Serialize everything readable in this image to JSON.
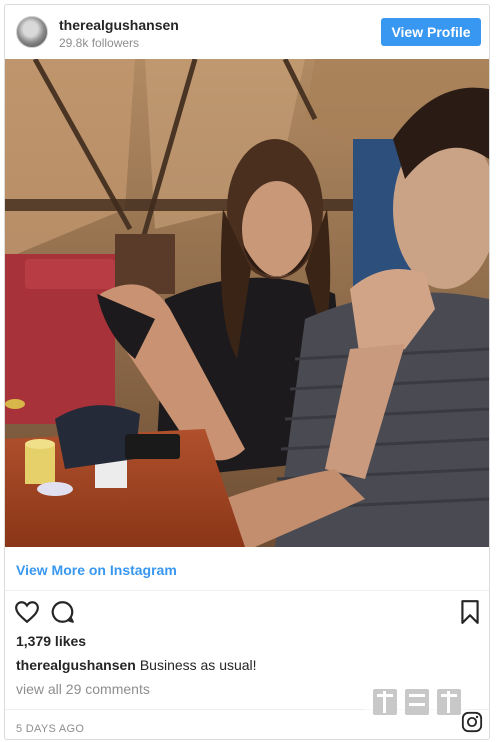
{
  "header": {
    "username": "therealgushansen",
    "followers": "29.8k followers",
    "view_profile_label": "View Profile"
  },
  "link": {
    "view_more_label": "View More on Instagram"
  },
  "post": {
    "likes": "1,379 likes",
    "caption_user": "therealgushansen",
    "caption_text": "Business as usual!",
    "comments_link": "view all 29 comments",
    "time": "5 DAYS AGO"
  },
  "icons": {
    "like": "heart-icon",
    "comment": "comment-icon",
    "save": "bookmark-icon",
    "instagram": "instagram-icon"
  },
  "colors": {
    "accent": "#3897f0",
    "text": "#262626",
    "muted": "#8e8e8e"
  }
}
